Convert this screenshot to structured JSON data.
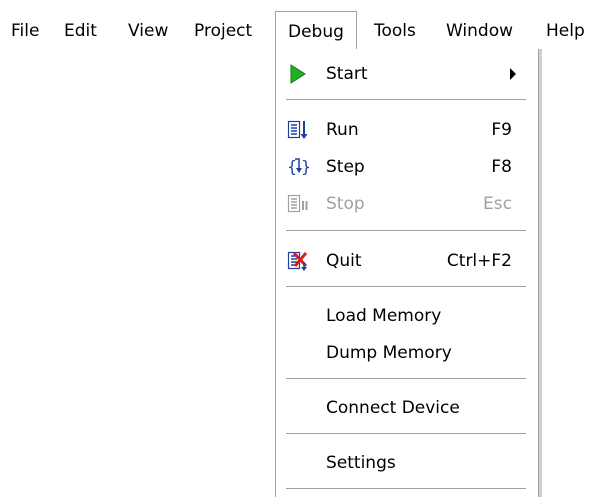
{
  "menubar": {
    "items": [
      "File",
      "Edit",
      "View",
      "Project",
      "Debug",
      "Tools",
      "Window",
      "Help"
    ]
  },
  "debug_menu": {
    "start": {
      "label": "Start",
      "icon": "play-icon"
    },
    "run": {
      "label": "Run",
      "shortcut": "F9",
      "icon": "run-icon"
    },
    "step": {
      "label": "Step",
      "shortcut": "F8",
      "icon": "step-icon"
    },
    "stop": {
      "label": "Stop",
      "shortcut": "Esc",
      "icon": "stop-icon",
      "disabled": true
    },
    "quit": {
      "label": "Quit",
      "shortcut": "Ctrl+F2",
      "icon": "quit-icon"
    },
    "load_memory": {
      "label": "Load Memory"
    },
    "dump_memory": {
      "label": "Dump Memory"
    },
    "connect_device": {
      "label": "Connect Device"
    },
    "settings": {
      "label": "Settings"
    }
  },
  "colors": {
    "play": "#22b022",
    "icon_blue": "#1f3fa0",
    "quit_red": "#d02020",
    "disabled": "#a0a0a0",
    "separator": "#a0a0a0"
  }
}
